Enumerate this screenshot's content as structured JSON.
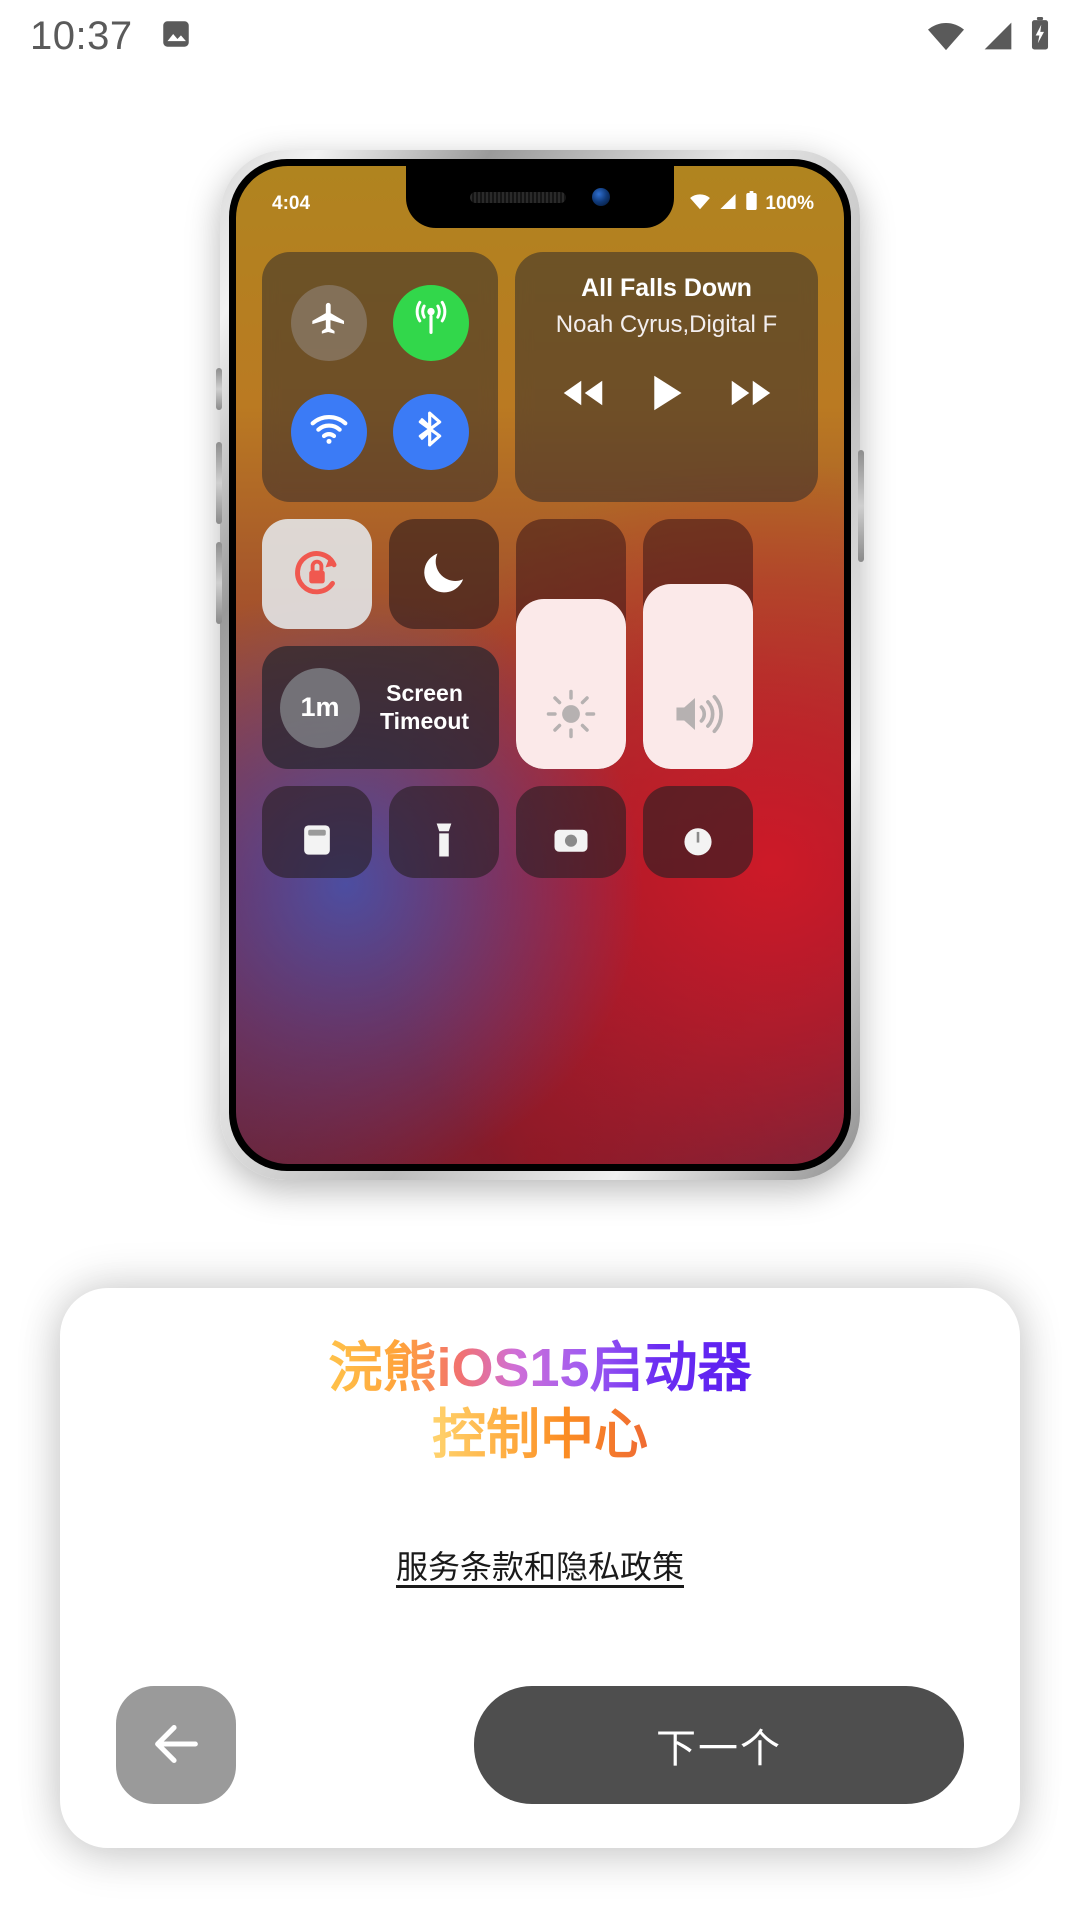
{
  "android_status_bar": {
    "clock": "10:37",
    "left_icons": [
      {
        "name": "gallery-image-icon"
      }
    ],
    "right_icons": [
      {
        "name": "wifi-icon"
      },
      {
        "name": "cellular-signal-icon"
      },
      {
        "name": "battery-charging-icon"
      }
    ]
  },
  "phone_preview": {
    "status_bar": {
      "time": "4:04",
      "battery_percent": "100%",
      "icons": [
        "wifi-icon",
        "cellular-signal-icon",
        "battery-icon"
      ]
    },
    "control_center": {
      "connectivity": {
        "airplane": {
          "name": "airplane-mode-icon",
          "state": "off",
          "color": "#968c87"
        },
        "cellular": {
          "name": "cellular-data-icon",
          "state": "on",
          "color": "#32d74b"
        },
        "wifi": {
          "name": "wifi-icon",
          "state": "on",
          "color": "#3b7bf6"
        },
        "bluetooth": {
          "name": "bluetooth-icon",
          "state": "on",
          "color": "#3b7bf6"
        }
      },
      "media": {
        "title": "All Falls Down",
        "artist": "Noah Cyrus,Digital F",
        "controls": [
          "rewind-icon",
          "play-icon",
          "forward-icon"
        ]
      },
      "rotation_lock": {
        "name": "rotation-lock-icon",
        "state": "on",
        "color": "#f0584f"
      },
      "do_not_disturb": {
        "name": "moon-icon",
        "state": "off"
      },
      "screen_timeout": {
        "value": "1m",
        "label_line1": "Screen",
        "label_line2": "Timeout"
      },
      "brightness_slider": {
        "name": "brightness-icon",
        "level": 68
      },
      "volume_slider": {
        "name": "volume-icon",
        "level": 74
      }
    }
  },
  "dialog": {
    "title": "浣熊iOS15启动器",
    "subtitle": "控制中心",
    "terms_link": "服务条款和隐私政策",
    "back_button": {
      "icon": "arrow-left-icon",
      "label": ""
    },
    "next_button": {
      "label": "下一个"
    }
  },
  "colors": {
    "next_button_bg": "#4e4e4e",
    "back_button_bg": "#9a9a9a",
    "title_gradient_start": "#ffc24a",
    "title_gradient_end": "#5a1ef0",
    "subtitle_gradient_start": "#ffd36e",
    "subtitle_gradient_end": "#ef6b33"
  }
}
